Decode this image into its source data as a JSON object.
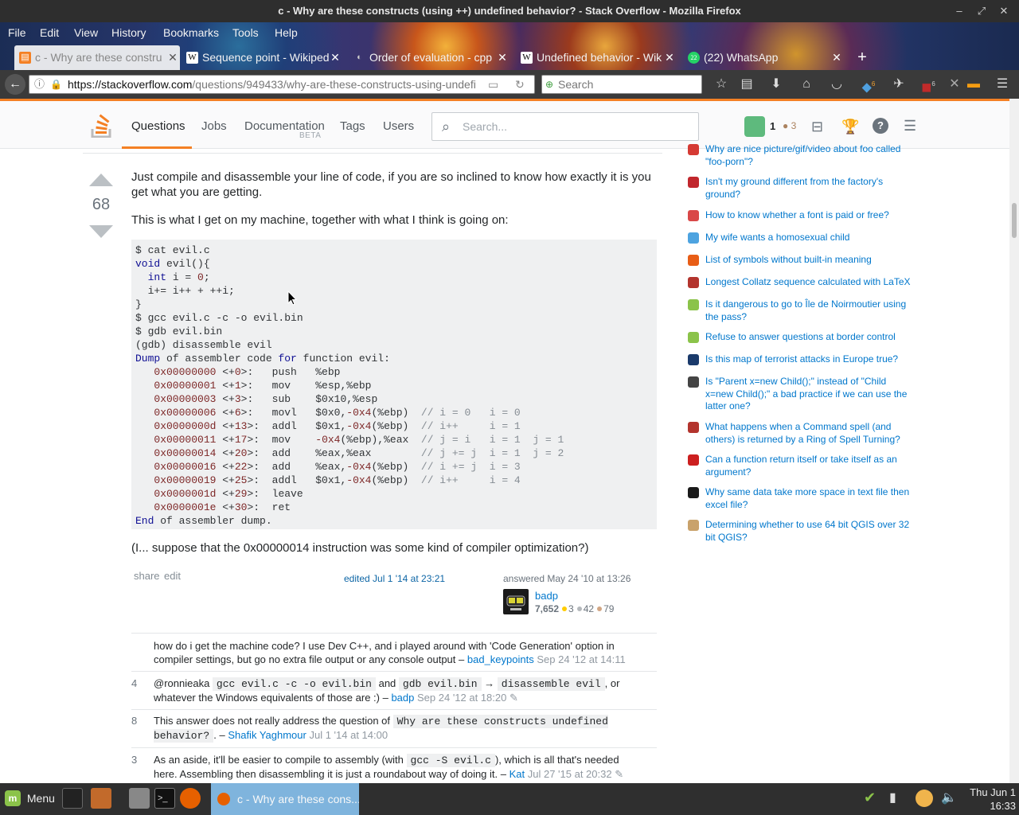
{
  "window": {
    "title": "c - Why are these constructs (using ++) undefined behavior? - Stack Overflow - Mozilla Firefox"
  },
  "menubar": [
    "File",
    "Edit",
    "View",
    "History",
    "Bookmarks",
    "Tools",
    "Help"
  ],
  "tabs": [
    {
      "label": "c - Why are these constru",
      "icon": "stackoverflow-favicon"
    },
    {
      "label": "Sequence point - Wikiped",
      "icon": "wikipedia-favicon"
    },
    {
      "label": "Order of evaluation - cpp",
      "icon": "cppreference-favicon"
    },
    {
      "label": "Undefined behavior - Wik",
      "icon": "wikipedia-favicon"
    },
    {
      "label": "(22) WhatsApp",
      "icon": "whatsapp-favicon",
      "badge": "22"
    }
  ],
  "navbar": {
    "url_host": "https://stackoverflow.com",
    "url_path": "/questions/949433/why-are-these-constructs-using-undefi",
    "search_placeholder": "Search",
    "ublock_badge": "6",
    "addon_badge": "6"
  },
  "so_header": {
    "nav": [
      {
        "label": "Questions"
      },
      {
        "label": "Jobs"
      },
      {
        "label": "Documentation",
        "sub": "BETA"
      },
      {
        "label": "Tags"
      },
      {
        "label": "Users"
      }
    ],
    "search_placeholder": "Search...",
    "rep": "1",
    "bronze": "3"
  },
  "answer": {
    "score": "68",
    "paragraph1": "Just compile and disassemble your line of code, if you are so inclined to know how exactly it is you get what you are getting.",
    "paragraph2": "This is what I get on my machine, together with what I think is going on:",
    "paragraph3": "(I... suppose that the 0x00000014 instruction was some kind of compiler optimization?)",
    "share": "share",
    "edit": "edit",
    "edited": "edited Jul 1 '14 at 23:21",
    "answered": "answered May 24 '10 at 13:26",
    "user": {
      "name": "badp",
      "rep": "7,652",
      "gold": "3",
      "silver": "42",
      "bronze": "79"
    }
  },
  "comments": [
    {
      "score": "",
      "text": "how do i get the machine code? I use Dev C++, and i played around with 'Code Generation' option in compiler settings, but go no extra file output or any console output –",
      "user": "bad_keypoints",
      "date": "Sep 24 '12 at 14:11"
    },
    {
      "score": "4",
      "pre": "@ronnieaka",
      "code1": "gcc evil.c -c -o evil.bin",
      "and": "and",
      "code2": "gdb evil.bin",
      "arrow": "→",
      "code3": "disassemble evil",
      "post": ", or whatever the Windows equivalents of those are :) –",
      "user": "badp",
      "date": "Sep 24 '12 at 18:20"
    },
    {
      "score": "8",
      "pre": "This answer does not really address the question of",
      "code1": "Why are these constructs undefined behavior?",
      "post": ". –",
      "user": "Shafik Yaghmour",
      "date": "Jul 1 '14 at 14:00"
    },
    {
      "score": "3",
      "pre": "As an aside, it'll be easier to compile to assembly (with",
      "code1": "gcc -S evil.c",
      "post": "), which is all that's needed here. Assembling then disassembling it is just a roundabout way of doing it. –",
      "user": "Kat",
      "date": "Jul 27 '15 at 20:32"
    }
  ],
  "sidebar": [
    {
      "text": "Why are nice picture/gif/video about foo called \"foo-porn\"?",
      "icon": "english-site-icon",
      "color": "#d53a33"
    },
    {
      "text": "Isn't my ground different from the factory's ground?",
      "icon": "electronics-site-icon",
      "color": "#c1272d"
    },
    {
      "text": "How to know whether a font is paid or free?",
      "icon": "graphic-design-site-icon",
      "color": "#d94848"
    },
    {
      "text": "My wife wants a homosexual child",
      "icon": "parenting-site-icon",
      "color": "#4da3e0"
    },
    {
      "text": "List of symbols without built-in meaning",
      "icon": "mathematica-site-icon",
      "color": "#e85d16"
    },
    {
      "text": "Longest Collatz sequence calculated with LaTeX",
      "icon": "tex-site-icon",
      "color": "#b3342d"
    },
    {
      "text": "Is it dangerous to go to Île de Noirmoutier using the pass?",
      "icon": "travel-site-icon",
      "color": "#8bc34a"
    },
    {
      "text": "Refuse to answer questions at border control",
      "icon": "travel-site-icon",
      "color": "#8bc34a"
    },
    {
      "text": "Is this map of terrorist attacks in Europe true?",
      "icon": "skeptics-site-icon",
      "color": "#1a3a6b"
    },
    {
      "text": "Is \"Parent x=new Child();\" instead of \"Child x=new Child();\" a bad practice if we can use the latter one?",
      "icon": "software-engineering-site-icon",
      "color": "#444444"
    },
    {
      "text": "What happens when a Command spell (and others) is returned by a Ring of Spell Turning?",
      "icon": "rpg-site-icon",
      "color": "#b3342d"
    },
    {
      "text": "Can a function return itself or take itself as an argument?",
      "icon": "math-site-icon",
      "color": "#cc1f1f"
    },
    {
      "text": "Why same data take more space in text file then excel file?",
      "icon": "superuser-site-icon",
      "color": "#1a1a1a"
    },
    {
      "text": "Determining whether to use 64 bit QGIS over 32 bit QGIS?",
      "icon": "gis-site-icon",
      "color": "#c9a26b"
    }
  ],
  "taskbar": {
    "menu_label": "Menu",
    "window_label": "c - Why are these cons...",
    "clock_day": "Thu Jun  1",
    "clock_time": "16:33"
  }
}
